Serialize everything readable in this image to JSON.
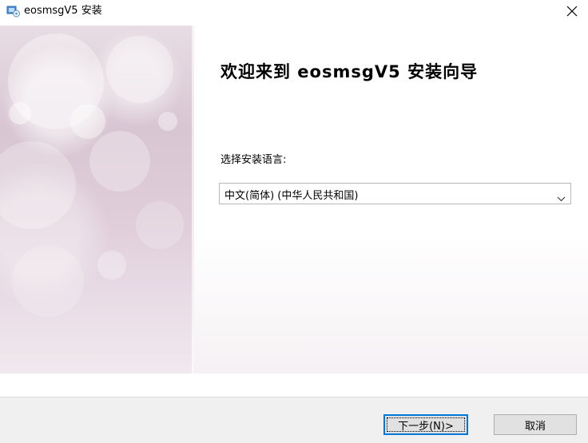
{
  "window": {
    "title": "eosmsgV5 安装",
    "icon": "installer-icon",
    "close_icon": "close-icon"
  },
  "content": {
    "heading": "欢迎来到 eosmsgV5 安装向导",
    "language_label": "选择安装语言:",
    "language_select": {
      "value": "中文(简体) (中华人民共和国)",
      "icon": "chevron-down-icon"
    }
  },
  "footer": {
    "next_label": "下一步(N)>",
    "cancel_label": "取消"
  },
  "colors": {
    "accent": "#0078d7",
    "footer_bg": "#f0f0f0",
    "button_bg": "#e1e1e1"
  }
}
